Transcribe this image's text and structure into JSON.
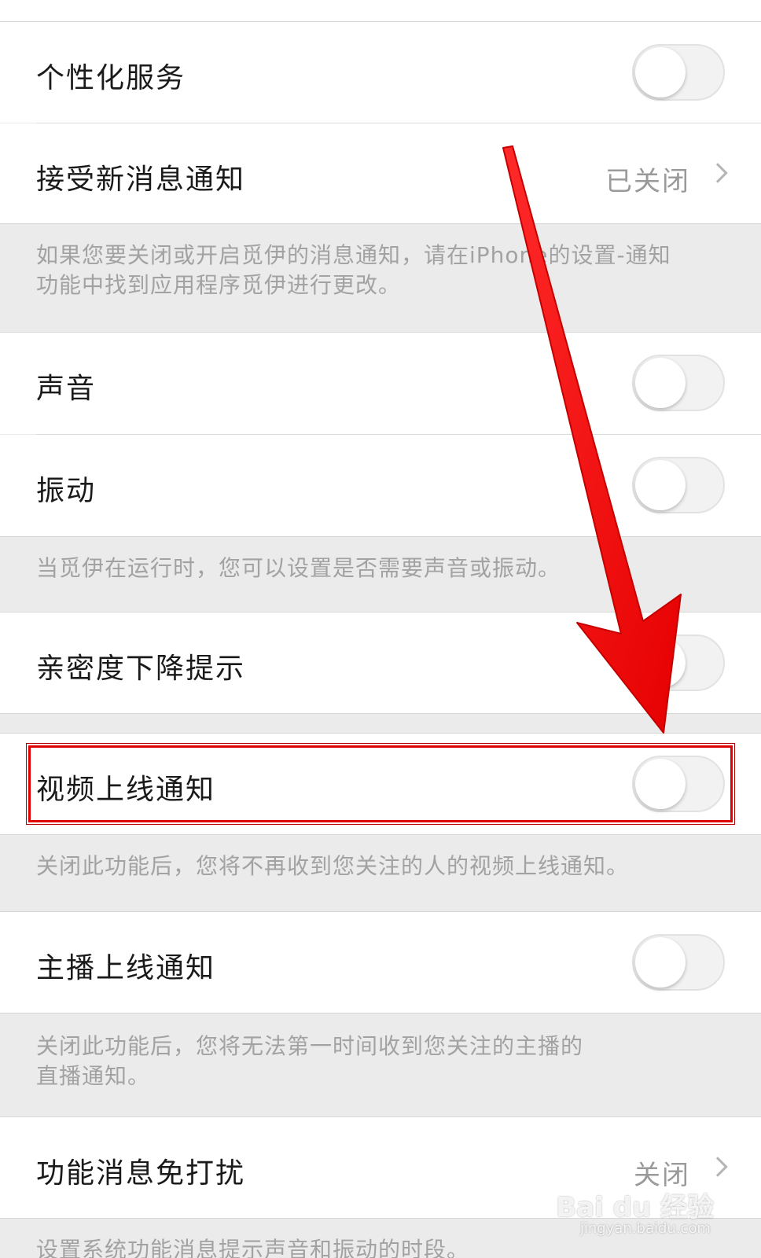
{
  "rows": {
    "personalized": {
      "label": "个性化服务",
      "toggle_on": false
    },
    "new_message": {
      "label": "接受新消息通知",
      "value": "已关闭"
    },
    "sound": {
      "label": "声音",
      "toggle_on": false
    },
    "vibrate": {
      "label": "振动",
      "toggle_on": false
    },
    "intimacy": {
      "label": "亲密度下降提示",
      "toggle_on": false
    },
    "video_online": {
      "label": "视频上线通知",
      "toggle_on": false
    },
    "anchor_online": {
      "label": "主播上线通知",
      "toggle_on": false
    },
    "dnd": {
      "label": "功能消息免打扰",
      "value": "关闭"
    }
  },
  "notes": {
    "new_message_line1": "如果您要关闭或开启觅伊的消息通知，请在iPhone的设置-通知",
    "new_message_line2": "功能中找到应用程序觅伊进行更改。",
    "sound_vibrate": "当觅伊在运行时，您可以设置是否需要声音或振动。",
    "video_online": "关闭此功能后，您将不再收到您关注的人的视频上线通知。",
    "anchor_line1": "关闭此功能后，您将无法第一时间收到您关注的主播的",
    "anchor_line2": "直播通知。",
    "dnd": "设置系统功能消息提示声音和振动的时段。"
  },
  "watermark": {
    "brand": "Bai du 经验",
    "url": "jingyan.baidu.com"
  },
  "colors": {
    "arrow": "#ff0000",
    "highlight": "#e00000",
    "background": "#ebebeb"
  }
}
